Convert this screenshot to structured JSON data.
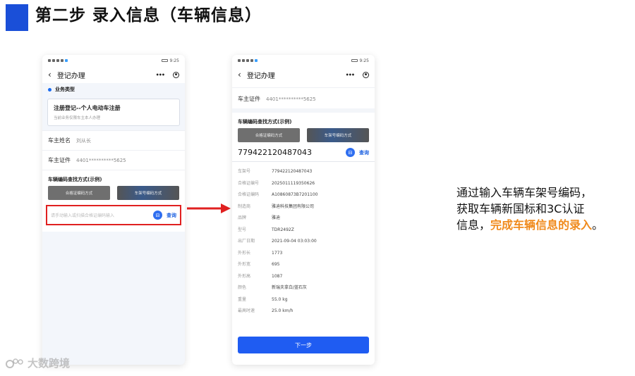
{
  "header": {
    "title": "第二步 录入信息（车辆信息）"
  },
  "phone_left": {
    "status": {
      "time": "9:25"
    },
    "nav": {
      "title": "登记办理"
    },
    "business_type_label": "业务类型",
    "card": {
      "title": "注册登记--个人电动车注册",
      "subtitle": "当前业务仅限车主本人办理"
    },
    "owner_name": {
      "label": "车主姓名",
      "value": "刘从长"
    },
    "owner_id": {
      "label": "车主证件",
      "value": "4401**********5625"
    },
    "find_title": "车辆编码查找方式(示例)",
    "img_btn_1": "合格证编码方式",
    "img_btn_2": "车架号编码方式",
    "search": {
      "placeholder": "请手动输入或扫描合格证编码输入",
      "query_label": "查询"
    }
  },
  "phone_right": {
    "status": {
      "time": "9:25"
    },
    "nav": {
      "title": "登记办理"
    },
    "owner_id": {
      "label": "车主证件",
      "value": "4401**********5625"
    },
    "find_title": "车辆编码查找方式(示例)",
    "img_btn_1": "合格证编码方式",
    "img_btn_2": "车架号编码方式",
    "vin_value": "779422120487043",
    "query_label": "查询",
    "info": [
      {
        "k": "车架号",
        "v": "779422120487043"
      },
      {
        "k": "合格证编号",
        "v": "2025011119350626"
      },
      {
        "k": "合格证编码",
        "v": "A10860873B7201100"
      },
      {
        "k": "制造商",
        "v": "雅迪科技集团有限公司"
      },
      {
        "k": "品牌",
        "v": "雅迪"
      },
      {
        "k": "型号",
        "v": "TDR2492Z"
      },
      {
        "k": "出厂日期",
        "v": "2021-09-04 03:03:00"
      },
      {
        "k": "外形长",
        "v": "1773"
      },
      {
        "k": "外形宽",
        "v": "695"
      },
      {
        "k": "外形高",
        "v": "1087"
      },
      {
        "k": "颜色",
        "v": "新瑞夫拿白/蓝石灰"
      },
      {
        "k": "重量",
        "v": "55.0 kg"
      },
      {
        "k": "最高时速",
        "v": "25.0 km/h"
      }
    ],
    "next_label": "下一步"
  },
  "description": {
    "line1": "通过输入车辆车架号编码，",
    "line2": "获取车辆新国标和3C认证",
    "line3_plain": "信息，",
    "line3_highlight": "完成车辆信息的录入",
    "line3_end": "。"
  },
  "watermark": {
    "text": "大数跨境"
  },
  "colors": {
    "accent_blue": "#1a4fd8",
    "highlight_orange": "#f08a1c",
    "arrow_red": "#e02020"
  }
}
